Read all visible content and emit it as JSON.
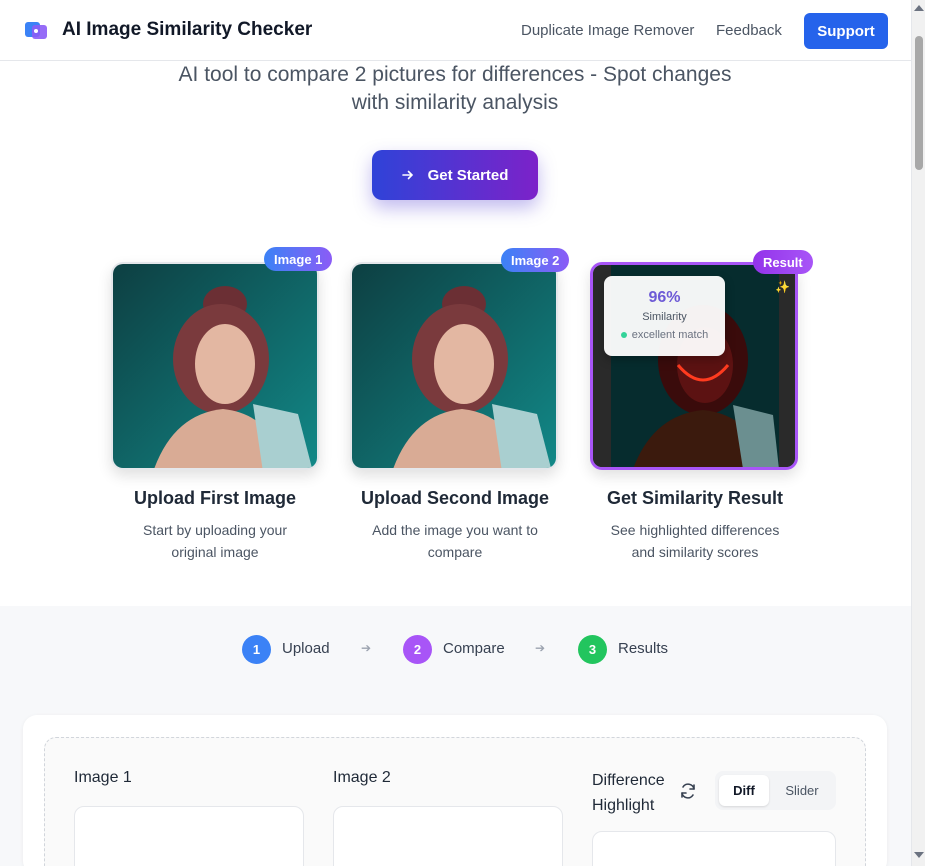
{
  "header": {
    "brand": "AI Image Similarity Checker",
    "logo_icon": "overlapping-squares-icon",
    "nav": [
      "Duplicate Image Remover",
      "Feedback"
    ],
    "support_label": "Support"
  },
  "hero": {
    "tagline_line1": "AI tool to compare 2 pictures for differences - Spot changes",
    "tagline_line2": "with similarity analysis",
    "cta_label": "Get Started",
    "cta_icon": "arrow-right-icon"
  },
  "steps": [
    {
      "badge": "Image 1",
      "title": "Upload First Image",
      "desc_line1": "Start by uploading your",
      "desc_line2": "original image"
    },
    {
      "badge": "Image 2",
      "title": "Upload Second Image",
      "desc_line1": "Add the image you want to",
      "desc_line2": "compare"
    },
    {
      "badge": "Result",
      "title": "Get Similarity Result",
      "desc_line1": "See highlighted differences",
      "desc_line2": "and similarity scores"
    }
  ],
  "result_popup": {
    "percent": "96%",
    "label": "Similarity",
    "status": "excellent match",
    "sparkle_icon": "sparkle-icon"
  },
  "progress": [
    {
      "num": "1",
      "label": "Upload"
    },
    {
      "num": "2",
      "label": "Compare"
    },
    {
      "num": "3",
      "label": "Results"
    }
  ],
  "compare": {
    "image1_label": "Image 1",
    "image2_label": "Image 2",
    "diff_label_line1": "Difference",
    "diff_label_line2": "Highlight",
    "refresh_icon": "refresh-icon",
    "toggle": [
      "Diff",
      "Slider"
    ]
  },
  "colors": {
    "primary": "#2563eb",
    "gradient_start": "#2f43d8",
    "gradient_end": "#7c22c9",
    "step1": "#3b82f6",
    "step2": "#a855f7",
    "step3": "#22c55e"
  }
}
